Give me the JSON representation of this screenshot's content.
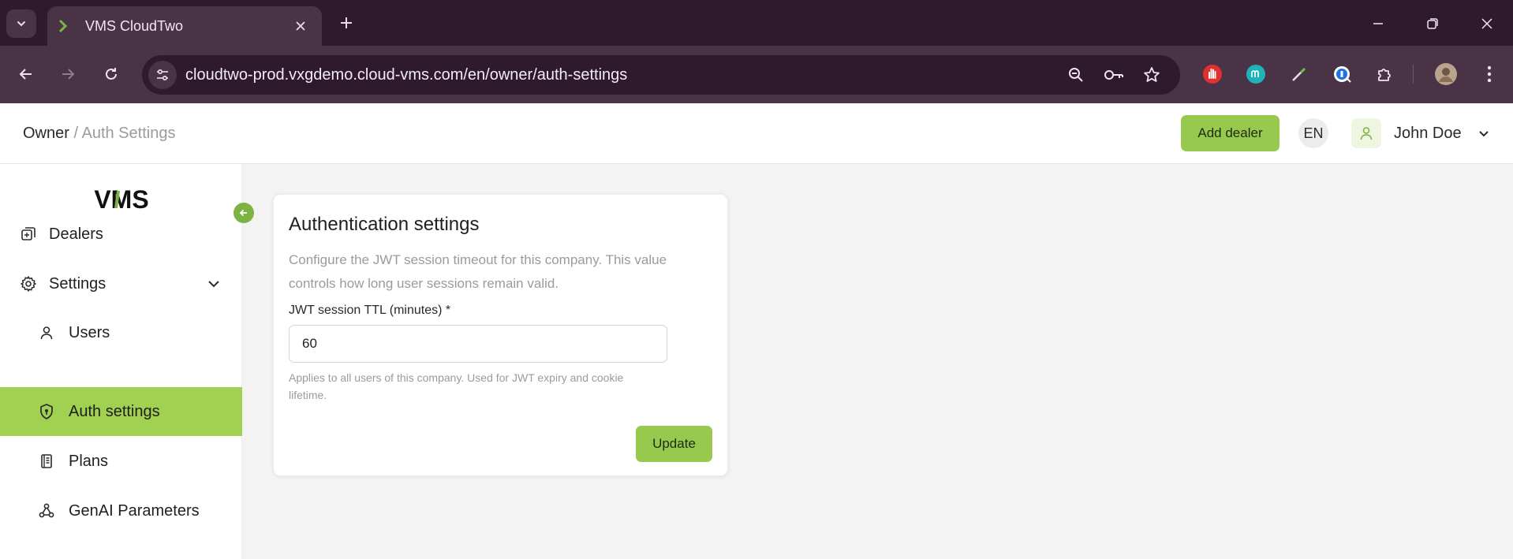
{
  "browser": {
    "tab_title": "VMS CloudTwo",
    "url": "cloudtwo-prod.vxgdemo.cloud-vms.com/en/owner/auth-settings"
  },
  "header": {
    "breadcrumb_root": "Owner",
    "breadcrumb_sep": "/",
    "breadcrumb_current": "Auth Settings",
    "add_dealer_label": "Add dealer",
    "language": "EN",
    "user_name": "John Doe"
  },
  "sidebar": {
    "logo_text": "VMS",
    "items": [
      {
        "label": "Dealers",
        "icon": "dealers-icon"
      },
      {
        "label": "Settings",
        "icon": "gear-icon"
      },
      {
        "label": "Users",
        "icon": "user-icon"
      },
      {
        "label": "Auth settings",
        "icon": "shield-icon"
      },
      {
        "label": "Plans",
        "icon": "plans-icon"
      },
      {
        "label": "GenAI Parameters",
        "icon": "webhook-icon"
      }
    ]
  },
  "card": {
    "title": "Authentication settings",
    "description": "Configure the JWT session timeout for this company. This value controls how long user sessions remain valid.",
    "field_label": "JWT session TTL (minutes) *",
    "field_value": "60",
    "field_help": "Applies to all users of this company. Used for JWT expiry and cookie lifetime.",
    "update_label": "Update"
  },
  "colors": {
    "accent": "#98c94f",
    "active_nav": "#a0d150",
    "browser_frame": "#2e1a2c",
    "browser_toolbar": "#4a3347"
  }
}
